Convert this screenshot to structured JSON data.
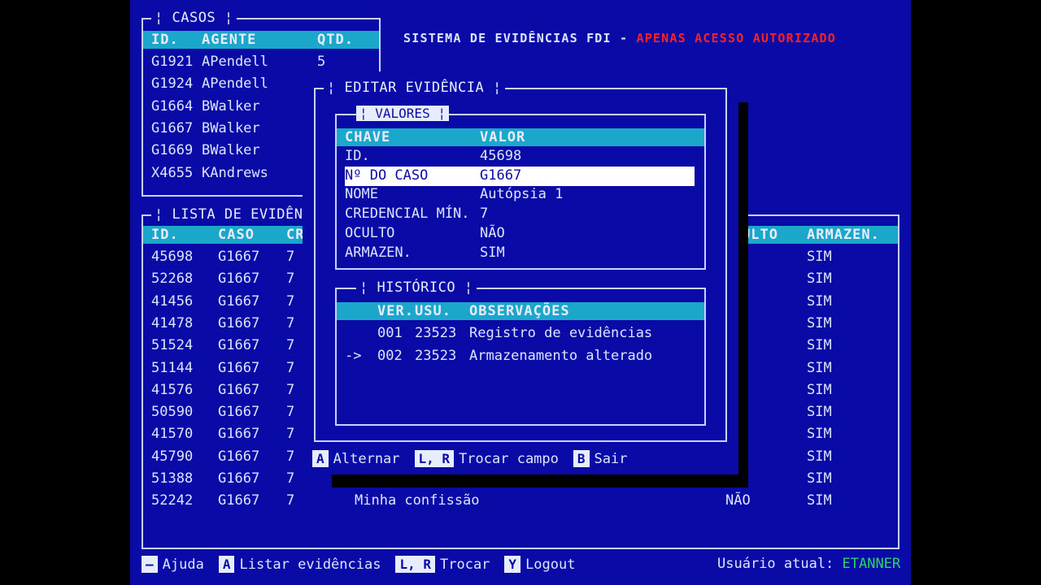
{
  "header": {
    "system_title": "SISTEMA DE EVIDÊNCIAS FDI -",
    "warning": "APENAS ACESSO AUTORIZADO"
  },
  "cases_panel": {
    "title": "CASOS",
    "columns": [
      "ID.",
      "AGENTE",
      "QTD."
    ],
    "rows": [
      {
        "id": "G1921",
        "agent": "APendell",
        "qty": "5"
      },
      {
        "id": "G1924",
        "agent": "APendell",
        "qty": ""
      },
      {
        "id": "G1664",
        "agent": "BWalker",
        "qty": ""
      },
      {
        "id": "G1667",
        "agent": "BWalker",
        "qty": ""
      },
      {
        "id": "G1669",
        "agent": "BWalker",
        "qty": ""
      },
      {
        "id": "X4655",
        "agent": "KAndrews",
        "qty": ""
      }
    ]
  },
  "evidence_panel": {
    "title": "LISTA DE EVIDÊN",
    "columns": [
      "ID.",
      "CASO",
      "CR",
      "ULTO",
      "ARMAZEN."
    ],
    "rows": [
      {
        "id": "45698",
        "case": "G1667",
        "cr": "7",
        "desc": "",
        "hidden": "",
        "stored": "SIM"
      },
      {
        "id": "52268",
        "case": "G1667",
        "cr": "7",
        "desc": "",
        "hidden": "",
        "stored": "SIM"
      },
      {
        "id": "41456",
        "case": "G1667",
        "cr": "7",
        "desc": "",
        "hidden": "",
        "stored": "SIM"
      },
      {
        "id": "41478",
        "case": "G1667",
        "cr": "7",
        "desc": "",
        "hidden": "",
        "stored": "SIM"
      },
      {
        "id": "51524",
        "case": "G1667",
        "cr": "7",
        "desc": "",
        "hidden": "",
        "stored": "SIM"
      },
      {
        "id": "51144",
        "case": "G1667",
        "cr": "7",
        "desc": "",
        "hidden": "",
        "stored": "SIM"
      },
      {
        "id": "41576",
        "case": "G1667",
        "cr": "7",
        "desc": "",
        "hidden": "",
        "stored": "SIM"
      },
      {
        "id": "50590",
        "case": "G1667",
        "cr": "7",
        "desc": "",
        "hidden": "",
        "stored": "SIM"
      },
      {
        "id": "41570",
        "case": "G1667",
        "cr": "7",
        "desc": "",
        "hidden": "",
        "stored": "SIM"
      },
      {
        "id": "45790",
        "case": "G1667",
        "cr": "7",
        "desc": "",
        "hidden": "",
        "stored": "SIM"
      },
      {
        "id": "51388",
        "case": "G1667",
        "cr": "7",
        "desc": "",
        "hidden": "",
        "stored": "SIM"
      },
      {
        "id": "52242",
        "case": "G1667",
        "cr": "7",
        "desc": "Minha confissão",
        "hidden": "NÃO",
        "stored": "SIM"
      }
    ]
  },
  "modal": {
    "title": "EDITAR EVIDÊNCIA",
    "values": {
      "title": "VALORES",
      "columns": [
        "CHAVE",
        "VALOR"
      ],
      "rows": [
        {
          "key": "ID.",
          "value": "45698"
        },
        {
          "key": "Nº DO CASO",
          "value": "G1667"
        },
        {
          "key": "NOME",
          "value": "Autópsia 1"
        },
        {
          "key": "CREDENCIAL MÍN.",
          "value": "7"
        },
        {
          "key": "OCULTO",
          "value": "NÃO"
        },
        {
          "key": "ARMAZEN.",
          "value": "SIM"
        }
      ]
    },
    "history": {
      "title": "HISTÓRICO",
      "columns": [
        "VER.",
        "USU.",
        "OBSERVAÇÕES"
      ],
      "rows": [
        {
          "marker": "",
          "ver": "001",
          "user": "23523",
          "note": "Registro de evidências"
        },
        {
          "marker": "->",
          "ver": "002",
          "user": "23523",
          "note": "Armazenamento alterado"
        }
      ]
    },
    "actions": [
      {
        "key": "A",
        "label": "Alternar"
      },
      {
        "key": "L, R",
        "label": "Trocar campo"
      },
      {
        "key": "B",
        "label": "Sair"
      }
    ]
  },
  "footer": {
    "actions": [
      {
        "key": "—",
        "label": "Ajuda"
      },
      {
        "key": "A",
        "label": "Listar evidências"
      },
      {
        "key": "L, R",
        "label": "Trocar"
      },
      {
        "key": "Y",
        "label": "Logout"
      }
    ],
    "user_label": "Usuário atual:",
    "username": "ETANNER"
  }
}
